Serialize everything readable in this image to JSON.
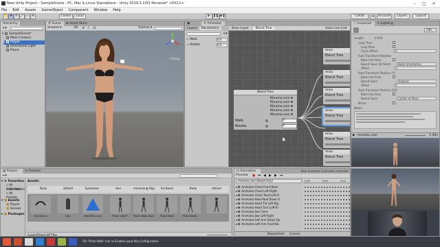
{
  "window": {
    "title": "New Unity Project - SampleScene - PC, Mac & Linux Standalone - Unity 2019.3.13f1 Personal* <DX11>"
  },
  "menu": [
    "File",
    "Edit",
    "Assets",
    "GameObject",
    "Component",
    "Window",
    "Help"
  ],
  "toolbar": {
    "pivot": "Pivot",
    "center": "Center",
    "local": "Local",
    "collab": "Collab",
    "account": "Account",
    "layers": "Layers",
    "layout": "Layout"
  },
  "hierarchy": {
    "tab": "Hierarchy",
    "items": [
      {
        "label": "SampleScene*",
        "depth": 0,
        "selected": false
      },
      {
        "label": "Main Camera",
        "depth": 1,
        "selected": false
      },
      {
        "label": "Player",
        "depth": 1,
        "selected": true
      },
      {
        "label": "Directional Light",
        "depth": 1,
        "selected": false
      },
      {
        "label": "Plane",
        "depth": 1,
        "selected": false
      }
    ]
  },
  "scene": {
    "tabs": [
      "Scene",
      "Asset Store"
    ],
    "shading": "Shaded",
    "mode_2d": "2D",
    "gizmos": "Gizmos",
    "persp_label": "< Persp"
  },
  "game_tab": "Game",
  "animator": {
    "tab": "Animator",
    "subtabs": [
      "Layers",
      "Parameters"
    ],
    "breadcrumb": [
      "Base Layer",
      "Blend Tree"
    ],
    "auto_live_link": "Auto Live Link",
    "parameters": [
      {
        "name": "Walk",
        "value": "0.0"
      },
      {
        "name": "Rotate",
        "value": "0.0"
      }
    ],
    "main_node": {
      "title": "Blend Tree",
      "motions": [
        "Mixamo.com",
        "Mixamo.com",
        "Mixamo.com",
        "Mixamo.com",
        "Mixamo.com"
      ],
      "params": [
        {
          "name": "Walk",
          "value": "0"
        },
        {
          "name": "Rotate",
          "value": "0"
        }
      ]
    },
    "child_nodes": [
      "mixa",
      "mixa",
      "mixa",
      "mixa",
      "mixa",
      "mixa"
    ],
    "child_label": "Blend Tree",
    "footer": "New Animator Controller.controller"
  },
  "inspector": {
    "tabs": [
      "Inspector",
      "Lighting"
    ],
    "edit_button": "Edit...",
    "rows": [
      {
        "label": "Length",
        "value": "0.933"
      },
      {
        "label": "Loop Time",
        "value": ""
      },
      {
        "label": "Loop Pose",
        "value": ""
      },
      {
        "label": "Cycle Offset",
        "value": "0"
      },
      {
        "label": "Root Transform Rotation",
        "value": ""
      },
      {
        "label": "Bake Into Pose",
        "value": ""
      },
      {
        "label": "Based Upon (at Start)",
        "value": "Body Orientation"
      },
      {
        "label": "Offset",
        "value": "0"
      },
      {
        "label": "Root Transform Position (Y)",
        "value": ""
      },
      {
        "label": "Bake Into Pose",
        "value": ""
      },
      {
        "label": "Based Upon",
        "value": "Original"
      },
      {
        "label": "Offset",
        "value": "0"
      },
      {
        "label": "Root Transform Position (XZ)",
        "value": ""
      },
      {
        "label": "Bake Into Pose",
        "value": ""
      },
      {
        "label": "Based Upon",
        "value": "Center of Mass"
      },
      {
        "label": "Mirror",
        "value": ""
      },
      {
        "label": "Notes",
        "value": ""
      }
    ],
    "preview_title": "mixamo.com",
    "preview_speed": "1.00x"
  },
  "project": {
    "tabs": [
      "Project",
      "Console"
    ],
    "favorites": {
      "title": "Favorites",
      "items": [
        "All Materials",
        "All Models",
        "All Prefabs"
      ]
    },
    "assets_tree": {
      "title": "Assets",
      "items": [
        "Player",
        "Scenes"
      ]
    },
    "packages": "Packages",
    "breadcrumb": "Assets",
    "header_row": [
      "Body",
      "default",
      "Eyelashes",
      "Hair",
      "mixamorig:Hips",
      "Ra Name",
      "Body",
      "default"
    ],
    "assets": [
      {
        "name": "Eyelashes",
        "icon": "mesh"
      },
      {
        "name": "Hair",
        "icon": "mesh"
      },
      {
        "name": "Idle(Mat.Line)",
        "icon": "triangle"
      },
      {
        "name": "Pistol Idle(F)",
        "icon": "figure"
      },
      {
        "name": "Pistol Walk Back..",
        "icon": "figure"
      },
      {
        "name": "Pistol Walk",
        "icon": "figure"
      },
      {
        "name": "Pistol Walk..",
        "icon": "figure"
      },
      {
        "name": "",
        "icon": "figure"
      }
    ],
    "footer_path": "Assets/Pistol LEFT.fbx"
  },
  "animation": {
    "tab": "Animation",
    "preview": "Preview",
    "clip": "mixamo.com (Read-Only)",
    "properties": [
      "Animator.Chest Front-Back",
      "Animator.Chest Left-Right",
      "Animator.Chest Twist Left-R",
      "Animator.Head Nod Down-U",
      "Animator.Head Tilt Left-Rig",
      "Animator.Head Turn Left-Ri",
      "Animator.Jaw Close",
      "Animator.Jaw Left-Right",
      "Animator.Left Arm Down-Up",
      "Animator.Left Arm Front-Ba"
    ],
    "bottom_tabs": [
      "Dopesheet",
      "Curves"
    ],
    "ruler": [
      "0:00",
      "0:05",
      "0:10"
    ]
  },
  "status": {
    "message": "File 'Pistol Walk' has no Enable Layer Key Configuration"
  },
  "colors": {
    "editor_bg": "#c2c2c2",
    "graph_bg": "#565656",
    "selection": "#4c8fd6",
    "play_blue": "#3c7fd0"
  }
}
